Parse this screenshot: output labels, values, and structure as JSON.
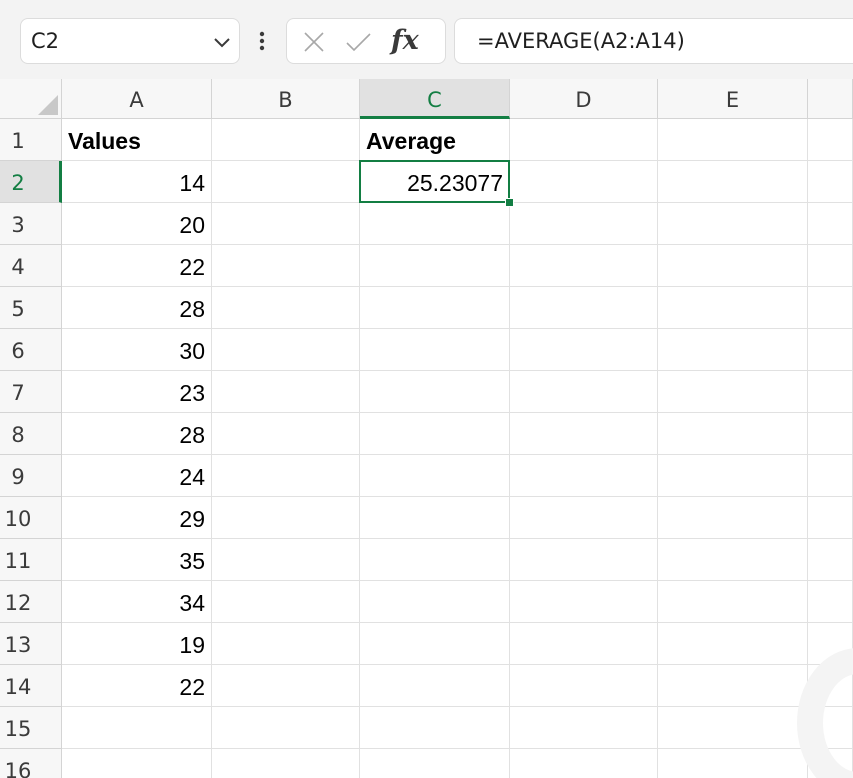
{
  "name_box": {
    "value": "C2",
    "dropdown_icon": "chevron-down-icon"
  },
  "formula_bar": {
    "divider_icon": "vertical-ellipsis-icon",
    "cancel_icon": "close-icon",
    "enter_icon": "checkmark-icon",
    "function_label": "fx",
    "formula": "=AVERAGE(A2:A14)"
  },
  "sheet": {
    "columns": [
      "A",
      "B",
      "C",
      "D",
      "E"
    ],
    "active_column": "C",
    "active_row": 2,
    "active_cell": "C2",
    "rows": [
      {
        "row": "1",
        "A": "Values",
        "C": "Average"
      },
      {
        "row": "2",
        "A": "14",
        "C": "25.23077"
      },
      {
        "row": "3",
        "A": "20"
      },
      {
        "row": "4",
        "A": "22"
      },
      {
        "row": "5",
        "A": "28"
      },
      {
        "row": "6",
        "A": "30"
      },
      {
        "row": "7",
        "A": "23"
      },
      {
        "row": "8",
        "A": "28"
      },
      {
        "row": "9",
        "A": "24"
      },
      {
        "row": "10",
        "A": "29"
      },
      {
        "row": "11",
        "A": "35"
      },
      {
        "row": "12",
        "A": "34"
      },
      {
        "row": "13",
        "A": "19"
      },
      {
        "row": "14",
        "A": "22"
      },
      {
        "row": "15"
      },
      {
        "row": "16"
      }
    ]
  },
  "colors": {
    "accent": "#137e43",
    "header_bg": "#f7f7f7",
    "active_header_bg": "#e1e1e1",
    "toolbar_bg": "#f3f3f3"
  }
}
